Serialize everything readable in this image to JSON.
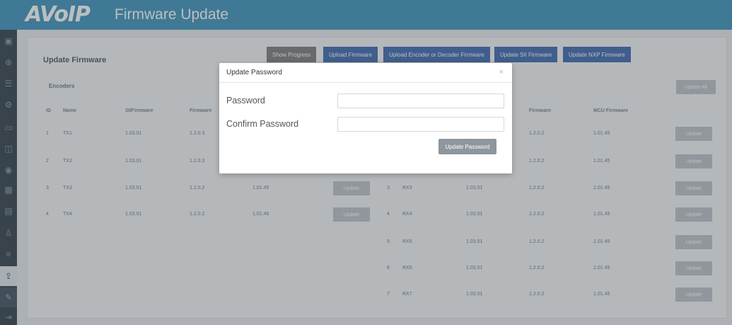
{
  "header": {
    "logo": "AVoIP",
    "title": "Firmware Update"
  },
  "sidebar": {
    "icons": [
      "dashboard-icon",
      "plus-circle-icon",
      "list-icon",
      "settings-icon",
      "display-icon",
      "monitor-icon",
      "circle-icon",
      "grid-icon",
      "table-icon",
      "user-icon",
      "sliders-icon",
      "upload-icon",
      "wrench-icon",
      "logout-icon"
    ]
  },
  "main": {
    "title": "Update Firmware",
    "toolbar": {
      "show_progress": "Show Progress",
      "upload_firmware": "Upload Firmware",
      "upload_encoder_decoder": "Upload Encoder or Decoder Firmware",
      "update_sii": "Update SII Firmware",
      "update_nxp": "Update NXP Firmware"
    },
    "encoders_label": "Encoders",
    "update_all": "Update All",
    "enc_headers": {
      "id": "ID",
      "name": "Name",
      "sii": "SIIFirmware",
      "fw": "Firmware"
    },
    "dec_headers": {
      "fw": "Firmware",
      "mcu": "MCU Firmware"
    },
    "update_label": "Update",
    "encoders": [
      {
        "id": "1",
        "name": "TX1",
        "sii": "1.03.01",
        "fw": "1.2.0.3",
        "mcu": ""
      },
      {
        "id": "2",
        "name": "TX2",
        "sii": "1.03.01",
        "fw": "1.2.0.3",
        "mcu": ""
      },
      {
        "id": "3",
        "name": "TX3",
        "sii": "1.03.01",
        "fw": "1.2.0.2",
        "mcu": "1.01.45"
      },
      {
        "id": "4",
        "name": "TX4",
        "sii": "1.03.01",
        "fw": "1.2.0.2",
        "mcu": "1.01.45"
      }
    ],
    "decoders": [
      {
        "id": "",
        "name": "",
        "sii": "",
        "fw": "1.2.0.2",
        "mcu": "1.01.45"
      },
      {
        "id": "",
        "name": "",
        "sii": "",
        "fw": "1.2.0.2",
        "mcu": "1.01.45"
      },
      {
        "id": "3",
        "name": "RX3",
        "sii": "1.03.01",
        "fw": "1.2.0.2",
        "mcu": "1.01.45"
      },
      {
        "id": "4",
        "name": "RX4",
        "sii": "1.03.01",
        "fw": "1.2.0.2",
        "mcu": "1.01.45"
      },
      {
        "id": "5",
        "name": "RX5",
        "sii": "1.03.01",
        "fw": "1.2.0.2",
        "mcu": "1.01.45"
      },
      {
        "id": "6",
        "name": "RX6",
        "sii": "1.03.01",
        "fw": "1.2.0.2",
        "mcu": "1.01.45"
      },
      {
        "id": "7",
        "name": "RX7",
        "sii": "1.03.01",
        "fw": "1.2.0.2",
        "mcu": "1.01.45"
      }
    ]
  },
  "modal": {
    "title": "Update Password",
    "close": "×",
    "password_label": "Password",
    "confirm_label": "Confirm Password",
    "password_value": "",
    "confirm_value": "",
    "submit": "Update Password"
  }
}
